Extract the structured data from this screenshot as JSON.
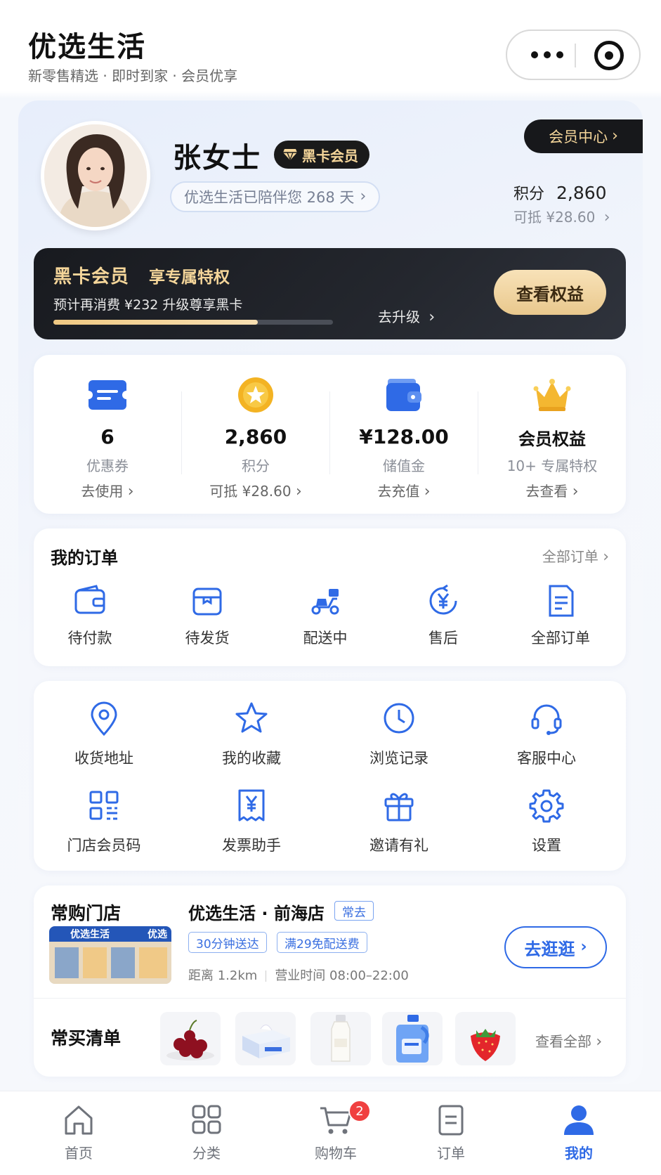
{
  "header": {
    "title": "优选生活",
    "subtitle": "新零售精选 · 即时到家 · 会员优享"
  },
  "profile": {
    "name": "张女士",
    "badge": "黑卡会员",
    "accompany_text": "优选生活已陪伴您 268 天",
    "member_center_label": "会员中心",
    "points_label": "积分",
    "points_value": "2,860",
    "points_offset": "可抵 ¥28.60"
  },
  "black_card": {
    "title": "黑卡会员",
    "subtitle": "享专属特权",
    "desc": "预计再消费 ¥232 升级尊享黑卡",
    "upgrade_label": "去升级",
    "button_label": "查看权益",
    "progress": 0.73
  },
  "assets": [
    {
      "value": "6",
      "label": "优惠券",
      "action": "去使用",
      "icon": "ticket-icon"
    },
    {
      "value": "2,860",
      "label": "积分",
      "action": "可抵 ¥28.60",
      "icon": "coin-icon"
    },
    {
      "value": "¥128.00",
      "label": "储值金",
      "action": "去充值",
      "icon": "wallet-icon"
    },
    {
      "value": "会员权益",
      "label": "10+ 专属特权",
      "action": "去查看",
      "icon": "crown-icon"
    }
  ],
  "orders": {
    "title": "我的订单",
    "all_link": "全部订单",
    "items": [
      {
        "label": "待付款",
        "icon": "wallet-outline-icon"
      },
      {
        "label": "待发货",
        "icon": "box-icon"
      },
      {
        "label": "配送中",
        "icon": "scooter-icon"
      },
      {
        "label": "售后",
        "icon": "yuan-refund-icon"
      },
      {
        "label": "全部订单",
        "icon": "document-icon"
      }
    ]
  },
  "services": [
    {
      "label": "收货地址",
      "icon": "location-pin-icon"
    },
    {
      "label": "我的收藏",
      "icon": "star-icon"
    },
    {
      "label": "浏览记录",
      "icon": "clock-icon"
    },
    {
      "label": "客服中心",
      "icon": "headset-icon"
    },
    {
      "label": "门店会员码",
      "icon": "qrcode-icon"
    },
    {
      "label": "发票助手",
      "icon": "invoice-icon"
    },
    {
      "label": "邀请有礼",
      "icon": "gift-icon"
    },
    {
      "label": "设置",
      "icon": "gear-icon"
    }
  ],
  "store": {
    "section_title": "常购门店",
    "name": "优选生活 · 前海店",
    "tag": "常去",
    "chips": [
      "30分钟送达",
      "满29免配送费"
    ],
    "distance": "距离 1.2km",
    "hours": "营业时间 08:00–22:00",
    "go_button": "去逛逛",
    "sign_text": "优选生活",
    "sign_text_2": "优选"
  },
  "frequent_list": {
    "title": "常买清单",
    "view_all": "查看全部",
    "products": [
      "cherries",
      "tissues",
      "milk-bottle",
      "detergent",
      "strawberry"
    ]
  },
  "tabbar": {
    "tabs": [
      {
        "label": "首页",
        "icon": "home-icon"
      },
      {
        "label": "分类",
        "icon": "grid-icon"
      },
      {
        "label": "购物车",
        "icon": "cart-icon",
        "badge": "2"
      },
      {
        "label": "订单",
        "icon": "order-doc-icon"
      },
      {
        "label": "我的",
        "icon": "person-icon"
      }
    ],
    "active_index": 4
  },
  "colors": {
    "accent": "#2f6ae6",
    "gold": "#f5d69a",
    "dark": "#17181b",
    "badge_red": "#f04040"
  }
}
